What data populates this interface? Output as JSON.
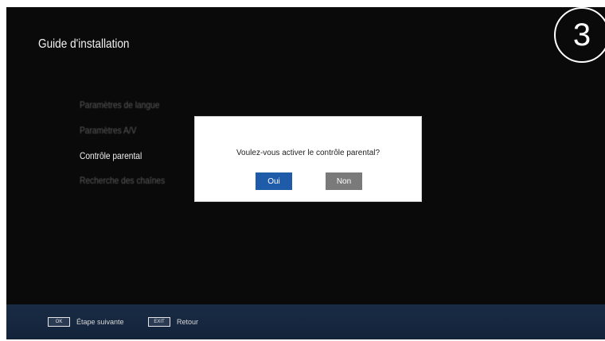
{
  "screen": {
    "title": "Guide d'installation",
    "step_number": "3"
  },
  "menu": {
    "items": [
      {
        "label": "Paramètres de langue",
        "state": "dim"
      },
      {
        "label": "Paramètres A/V",
        "state": "dim"
      },
      {
        "label": "Contrôle parental",
        "state": "active"
      },
      {
        "label": "Recherche des chaînes",
        "state": "dim"
      }
    ]
  },
  "dialog": {
    "message": "Voulez-vous activer le contrôle parental?",
    "yes_label": "Oui",
    "no_label": "Non",
    "colors": {
      "yes": "#1e5ba8",
      "no": "#7a7a7a"
    }
  },
  "footer": {
    "hints": [
      {
        "key": "OK",
        "label": "Étape suivante"
      },
      {
        "key": "EXIT",
        "label": "Retour"
      }
    ]
  }
}
